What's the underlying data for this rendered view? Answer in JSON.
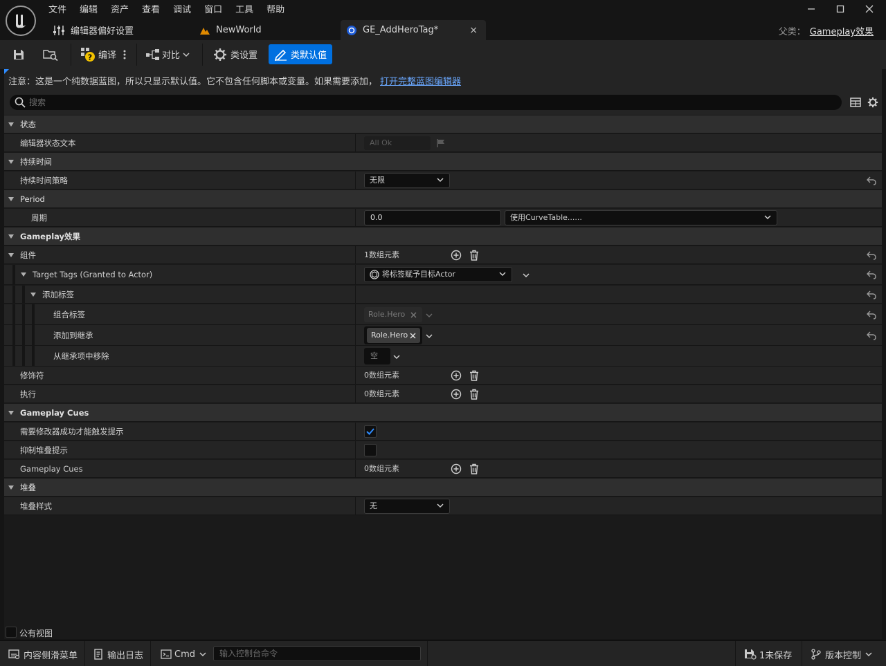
{
  "menu": [
    "文件",
    "编辑",
    "资产",
    "查看",
    "调试",
    "窗口",
    "工具",
    "帮助"
  ],
  "tabs": {
    "editor_prefs": "编辑器偏好设置",
    "new_world": "NewWorld",
    "asset": "GE_AddHeroTag*",
    "close": "×"
  },
  "parent": {
    "label": "父类：",
    "value": "Gameplay效果"
  },
  "toolbar": {
    "compile": "编译",
    "diff": "对比",
    "class_settings": "类设置",
    "class_defaults": "类默认值"
  },
  "notice": {
    "text": "注意：这是一个纯数据蓝图，所以只显示默认值。它不包含任何脚本或变量。如果需要添加，",
    "link": "打开完整蓝图编辑器"
  },
  "search": {
    "placeholder": "搜索"
  },
  "details": {
    "status_category": "状态",
    "editor_status_text": "编辑器状态文本",
    "editor_status_value": "All Ok",
    "duration_category": "持续时间",
    "duration_policy": "持续时间策略",
    "duration_policy_value": "无限",
    "period_category": "Period",
    "period": "周期",
    "period_value": "0.0",
    "period_curve": "使用CurveTable......",
    "ge_category": "Gameplay效果",
    "components": "组件",
    "components_count": "1数组元素",
    "target_tags": "Target Tags (Granted to Actor)",
    "target_tags_value": "将标签赋予目标Actor",
    "add_tags": "添加标签",
    "combined_tags": "组合标签",
    "combined_tags_value": "Role.Hero",
    "added_tags": "添加到继承",
    "added_tags_value": "Role.Hero",
    "removed_tags": "从继承项中移除",
    "removed_tags_value": "空",
    "modifiers": "修饰符",
    "modifiers_count": "0数组元素",
    "executions": "执行",
    "executions_count": "0数组元素",
    "cues_category": "Gameplay Cues",
    "require_modifier_success": "需要修改器成功才能触发提示",
    "require_modifier_success_checked": true,
    "suppress_stacking_cues": "抑制堆叠提示",
    "suppress_stacking_cues_checked": false,
    "gameplay_cues": "Gameplay Cues",
    "gameplay_cues_count": "0数组元素",
    "stacking_category": "堆叠",
    "stacking_type": "堆叠样式",
    "stacking_type_value": "无"
  },
  "public_view": "公有视图",
  "statusbar": {
    "content_drawer": "内容侧滑菜单",
    "output_log": "输出日志",
    "cmd": "Cmd",
    "console_placeholder": "输入控制台命令",
    "unsaved": "1未保存",
    "source_control": "版本控制"
  },
  "colors": {
    "accent": "#0070e0",
    "link": "#6aa8ff",
    "panel": "#242424",
    "category": "#2f2f2f"
  }
}
